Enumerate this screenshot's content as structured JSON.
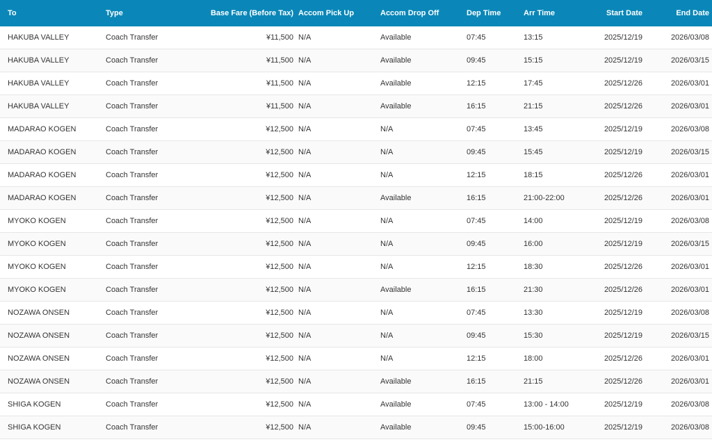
{
  "table": {
    "headers": {
      "to": "To",
      "type": "Type",
      "fare": "Base Fare (Before Tax)",
      "pickup": "Accom Pick Up",
      "dropoff": "Accom Drop Off",
      "dep": "Dep Time",
      "arr": "Arr Time",
      "start": "Start Date",
      "end": "End Date"
    },
    "rows": [
      {
        "to": "HAKUBA VALLEY",
        "type": "Coach Transfer",
        "fare": "¥11,500",
        "pickup": "N/A",
        "dropoff": "Available",
        "dep": "07:45",
        "arr": "13:15",
        "start": "2025/12/19",
        "end": "2026/03/08"
      },
      {
        "to": "HAKUBA VALLEY",
        "type": "Coach Transfer",
        "fare": "¥11,500",
        "pickup": "N/A",
        "dropoff": "Available",
        "dep": "09:45",
        "arr": "15:15",
        "start": "2025/12/19",
        "end": "2026/03/15"
      },
      {
        "to": "HAKUBA VALLEY",
        "type": "Coach Transfer",
        "fare": "¥11,500",
        "pickup": "N/A",
        "dropoff": "Available",
        "dep": "12:15",
        "arr": "17:45",
        "start": "2025/12/26",
        "end": "2026/03/01"
      },
      {
        "to": "HAKUBA VALLEY",
        "type": "Coach Transfer",
        "fare": "¥11,500",
        "pickup": "N/A",
        "dropoff": "Available",
        "dep": "16:15",
        "arr": "21:15",
        "start": "2025/12/26",
        "end": "2026/03/01"
      },
      {
        "to": "MADARAO KOGEN",
        "type": "Coach Transfer",
        "fare": "¥12,500",
        "pickup": "N/A",
        "dropoff": "N/A",
        "dep": "07:45",
        "arr": "13:45",
        "start": "2025/12/19",
        "end": "2026/03/08"
      },
      {
        "to": "MADARAO KOGEN",
        "type": "Coach Transfer",
        "fare": "¥12,500",
        "pickup": "N/A",
        "dropoff": "N/A",
        "dep": "09:45",
        "arr": "15:45",
        "start": "2025/12/19",
        "end": "2026/03/15"
      },
      {
        "to": "MADARAO KOGEN",
        "type": "Coach Transfer",
        "fare": "¥12,500",
        "pickup": "N/A",
        "dropoff": "N/A",
        "dep": "12:15",
        "arr": "18:15",
        "start": "2025/12/26",
        "end": "2026/03/01"
      },
      {
        "to": "MADARAO KOGEN",
        "type": "Coach Transfer",
        "fare": "¥12,500",
        "pickup": "N/A",
        "dropoff": "Available",
        "dep": "16:15",
        "arr": "21:00-22:00",
        "start": "2025/12/26",
        "end": "2026/03/01"
      },
      {
        "to": "MYOKO KOGEN",
        "type": "Coach Transfer",
        "fare": "¥12,500",
        "pickup": "N/A",
        "dropoff": "N/A",
        "dep": "07:45",
        "arr": "14:00",
        "start": "2025/12/19",
        "end": "2026/03/08"
      },
      {
        "to": "MYOKO KOGEN",
        "type": "Coach Transfer",
        "fare": "¥12,500",
        "pickup": "N/A",
        "dropoff": "N/A",
        "dep": "09:45",
        "arr": "16:00",
        "start": "2025/12/19",
        "end": "2026/03/15"
      },
      {
        "to": "MYOKO KOGEN",
        "type": "Coach Transfer",
        "fare": "¥12,500",
        "pickup": "N/A",
        "dropoff": "N/A",
        "dep": "12:15",
        "arr": "18:30",
        "start": "2025/12/26",
        "end": "2026/03/01"
      },
      {
        "to": "MYOKO KOGEN",
        "type": "Coach Transfer",
        "fare": "¥12,500",
        "pickup": "N/A",
        "dropoff": "Available",
        "dep": "16:15",
        "arr": "21:30",
        "start": "2025/12/26",
        "end": "2026/03/01"
      },
      {
        "to": "NOZAWA ONSEN",
        "type": "Coach Transfer",
        "fare": "¥12,500",
        "pickup": "N/A",
        "dropoff": "N/A",
        "dep": "07:45",
        "arr": "13:30",
        "start": "2025/12/19",
        "end": "2026/03/08"
      },
      {
        "to": "NOZAWA ONSEN",
        "type": "Coach Transfer",
        "fare": "¥12,500",
        "pickup": "N/A",
        "dropoff": "N/A",
        "dep": "09:45",
        "arr": "15:30",
        "start": "2025/12/19",
        "end": "2026/03/15"
      },
      {
        "to": "NOZAWA ONSEN",
        "type": "Coach Transfer",
        "fare": "¥12,500",
        "pickup": "N/A",
        "dropoff": "N/A",
        "dep": "12:15",
        "arr": "18:00",
        "start": "2025/12/26",
        "end": "2026/03/01"
      },
      {
        "to": "NOZAWA ONSEN",
        "type": "Coach Transfer",
        "fare": "¥12,500",
        "pickup": "N/A",
        "dropoff": "Available",
        "dep": "16:15",
        "arr": "21:15",
        "start": "2025/12/26",
        "end": "2026/03/01"
      },
      {
        "to": "SHIGA KOGEN",
        "type": "Coach Transfer",
        "fare": "¥12,500",
        "pickup": "N/A",
        "dropoff": "Available",
        "dep": "07:45",
        "arr": "13:00 - 14:00",
        "start": "2025/12/19",
        "end": "2026/03/08"
      },
      {
        "to": "SHIGA KOGEN",
        "type": "Coach Transfer",
        "fare": "¥12,500",
        "pickup": "N/A",
        "dropoff": "Available",
        "dep": "09:45",
        "arr": "15:00-16:00",
        "start": "2025/12/19",
        "end": "2026/03/08"
      }
    ]
  },
  "colors": {
    "header_bg": "#0a87b8",
    "header_text": "#ffffff",
    "row_border": "#e6e6e6"
  }
}
